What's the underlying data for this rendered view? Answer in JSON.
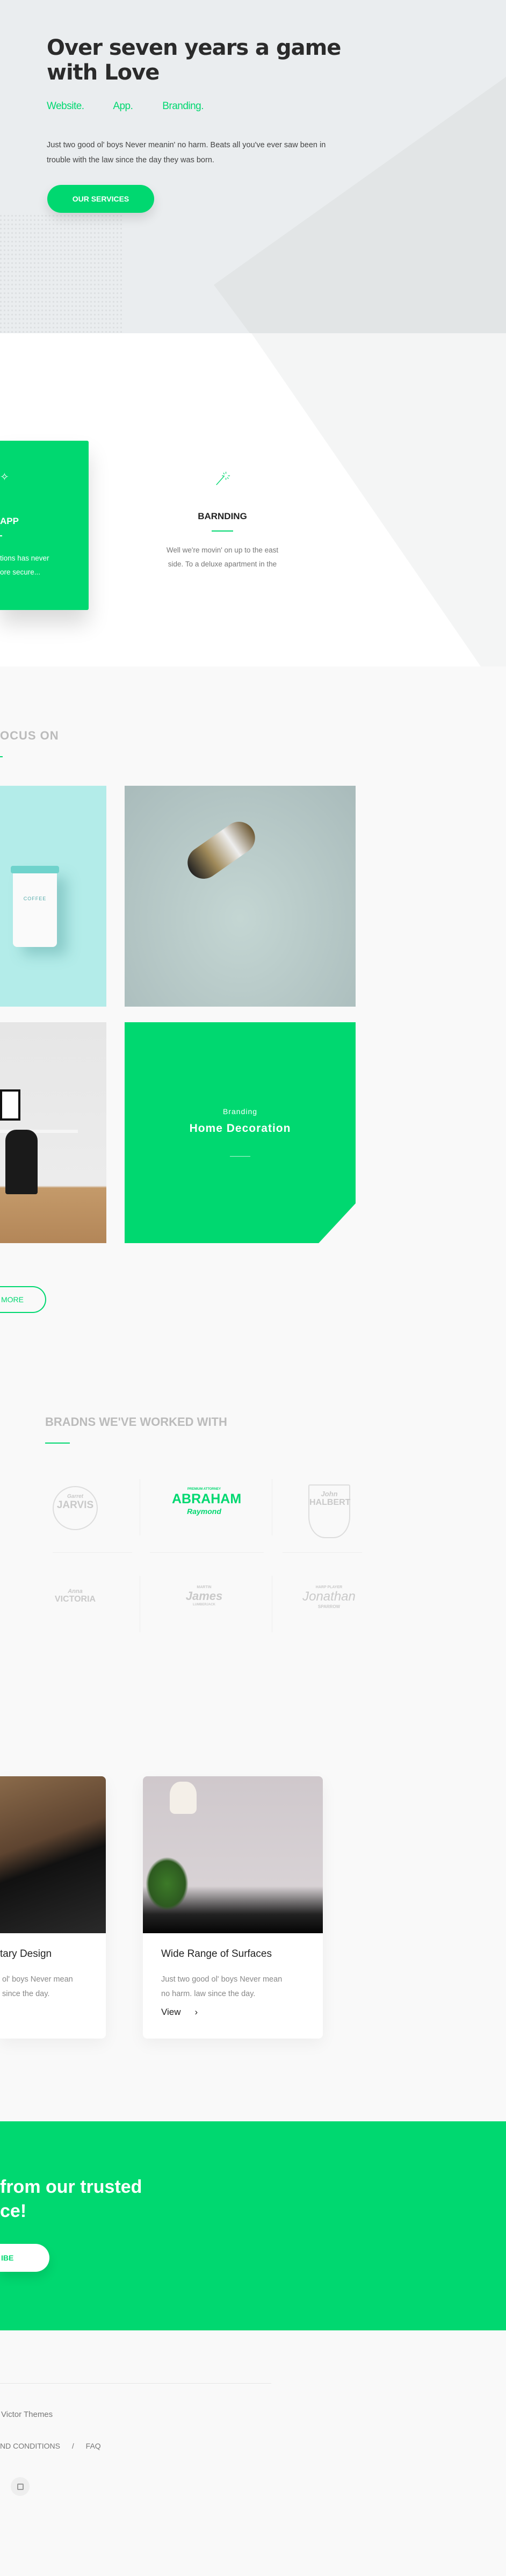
{
  "colors": {
    "accent": "#00d870",
    "hero_bg": "#eaedef"
  },
  "hero": {
    "title": "Over seven years a game with Love",
    "tags": [
      "Website.",
      "App.",
      "Branding."
    ],
    "text": "Just two good ol' boys Never meanin' no harm. Beats all you've ever saw been in trouble with the law since the day they was born.",
    "button": "OUR SERVICES"
  },
  "services": [
    {
      "icon": "magic-wand-icon",
      "title": "APP",
      "text_lines": [
        "tions has never",
        "ore secure..."
      ]
    },
    {
      "icon": "magic-wand-icon",
      "title": "BARNDING",
      "text_lines": [
        "Well we're movin' on up to the east",
        "side. To a deluxe apartment in the"
      ]
    }
  ],
  "focus": {
    "heading": "OCUS ON",
    "items": [
      {
        "image": "coffee-cup",
        "logo_text": "COFFEE"
      },
      {
        "image": "jumping-man"
      },
      {
        "image": "office-desk"
      },
      {
        "category": "Branding",
        "title": "Home Decoration"
      }
    ],
    "more_button": "MORE"
  },
  "brands": {
    "heading": "BRADNS WE'VE WORKED WITH",
    "logos": [
      {
        "top": "Garret",
        "main": "JARVIS"
      },
      {
        "top": "PREMIUM ATTORNEY",
        "main": "ABRAHAM",
        "sub": "Raymond"
      },
      {
        "top": "John",
        "main": "HALBERT"
      },
      {
        "top": "Anna",
        "main": "VICTORIA"
      },
      {
        "top": "MARTIN",
        "main": "James",
        "sub": "LUMBERJACK"
      },
      {
        "top": "HARP PLAYER",
        "main": "Jonathan",
        "sub": "SPARROW"
      }
    ]
  },
  "blog": [
    {
      "title": "tary Design",
      "text_lines": [
        "ol' boys Never mean",
        "since the day."
      ]
    },
    {
      "title": "Wide Range of Surfaces",
      "text_lines": [
        "Just two good ol' boys Never mean",
        "no harm.  law since the day."
      ],
      "link": "View",
      "link_icon": "chevron-right-icon"
    }
  ],
  "cta": {
    "lines": [
      "from our trusted",
      "ce!"
    ],
    "button": "IBE"
  },
  "footer": {
    "credit": "Victor Themes",
    "links": [
      "ND CONDITIONS",
      "/",
      "FAQ"
    ],
    "social": [
      "instagram-icon"
    ]
  }
}
